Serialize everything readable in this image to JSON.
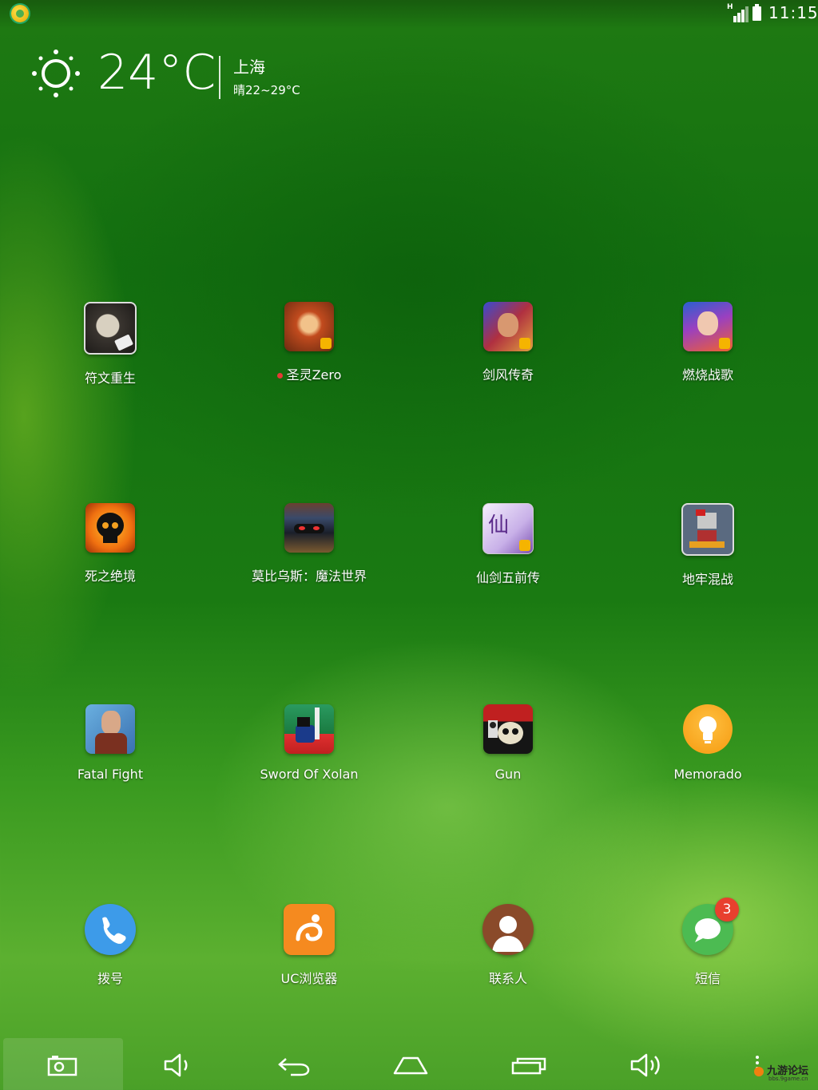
{
  "status_bar": {
    "time": "11:15",
    "network_type": "H",
    "notification_icon": "game-assistant-icon",
    "signal_icon": "signal-icon",
    "battery_icon": "battery-icon"
  },
  "weather": {
    "temperature": "24°C",
    "city": "上海",
    "range": "晴22~29°C",
    "icon": "sun-icon"
  },
  "apps": [
    {
      "label": "符文重生",
      "icon": "runic-rebirth-icon"
    },
    {
      "label": "圣灵Zero",
      "icon": "holy-spirit-zero-icon",
      "new_dot": true
    },
    {
      "label": "剑风传奇",
      "icon": "sword-wind-legend-icon"
    },
    {
      "label": "燃烧战歌",
      "icon": "burning-battle-song-icon"
    },
    {
      "label": "死之绝境",
      "icon": "dead-end-skull-icon"
    },
    {
      "label": "莫比乌斯：魔法世界",
      "icon": "mobius-magic-world-icon"
    },
    {
      "label": "仙剑五前传",
      "icon": "xianjian-five-prequel-icon"
    },
    {
      "label": "地牢混战",
      "icon": "dungeon-brawl-icon"
    },
    {
      "label": "Fatal Fight",
      "icon": "fatal-fight-icon"
    },
    {
      "label": "Sword Of Xolan",
      "icon": "sword-of-xolan-icon"
    },
    {
      "label": "Gun",
      "icon": "gun-skull-icon"
    },
    {
      "label": "Memorado",
      "icon": "lightbulb-icon"
    }
  ],
  "dock": [
    {
      "label": "拨号",
      "icon": "phone-icon",
      "color": "#3d9be9"
    },
    {
      "label": "UC浏览器",
      "icon": "uc-squirrel-icon",
      "color": "#f58a1f"
    },
    {
      "label": "联系人",
      "icon": "contact-person-icon",
      "color": "#8a4a2a"
    },
    {
      "label": "短信",
      "icon": "message-bubble-icon",
      "color": "#4cbb52",
      "badge": "3"
    }
  ],
  "nav_bar": {
    "buttons": [
      "screenshot-icon",
      "volume-down-icon",
      "back-icon",
      "home-icon",
      "recents-icon",
      "volume-up-icon"
    ]
  },
  "watermark": {
    "text": "九游论坛",
    "sub": "bbs.9game.cn"
  }
}
